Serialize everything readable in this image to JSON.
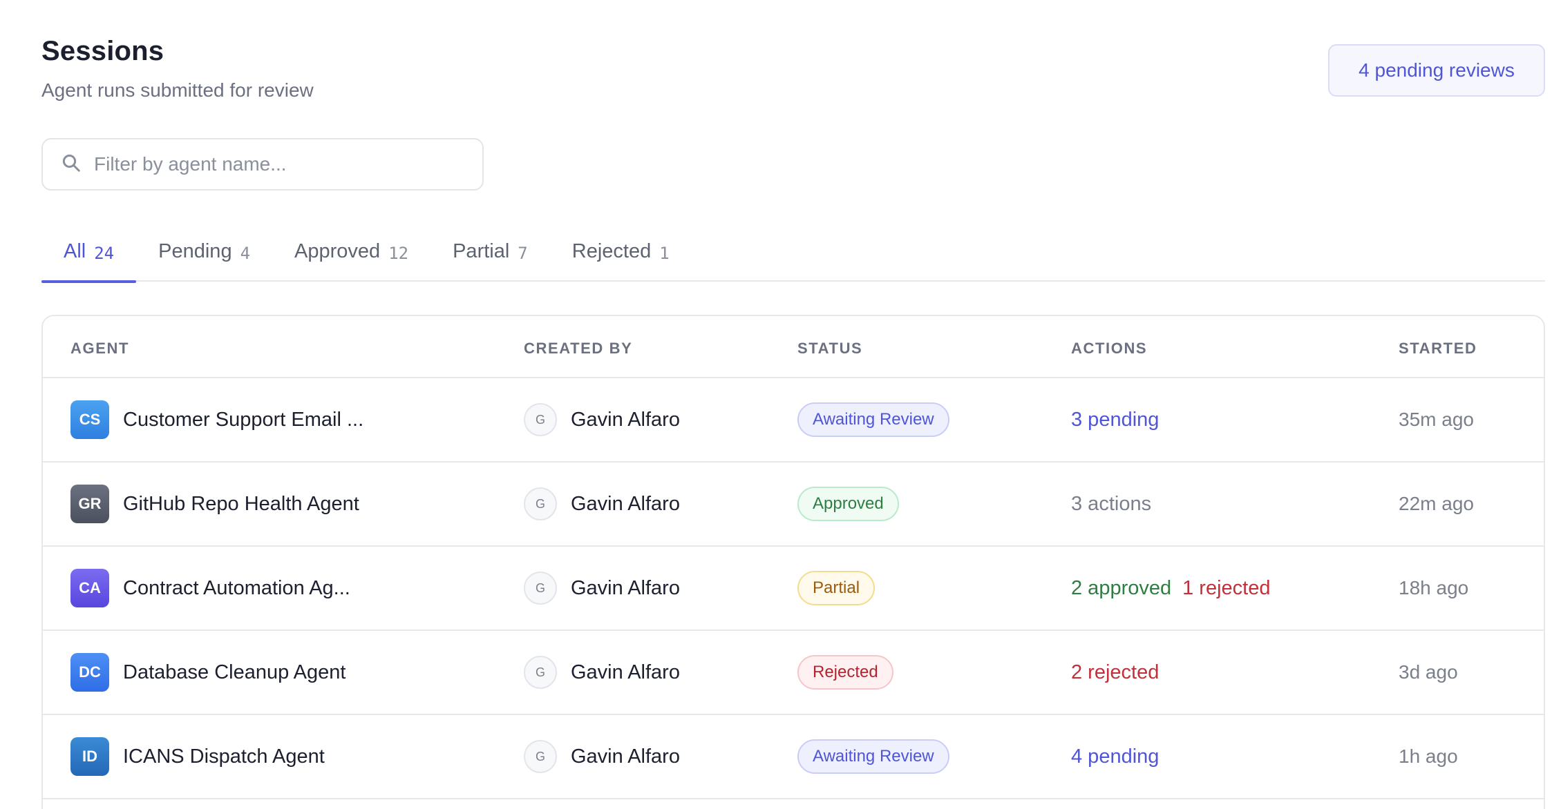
{
  "header": {
    "title": "Sessions",
    "subtitle": "Agent runs submitted for review",
    "pending_label": "4 pending reviews"
  },
  "search": {
    "placeholder": "Filter by agent name...",
    "value": ""
  },
  "tabs": [
    {
      "label": "All",
      "count": "24",
      "active": true
    },
    {
      "label": "Pending",
      "count": "4"
    },
    {
      "label": "Approved",
      "count": "12"
    },
    {
      "label": "Partial",
      "count": "7"
    },
    {
      "label": "Rejected",
      "count": "1"
    }
  ],
  "table": {
    "columns": [
      "AGENT",
      "CREATED BY",
      "STATUS",
      "ACTIONS",
      "STARTED"
    ],
    "rows": [
      {
        "initials": "CS",
        "avatar_color": "#3d8fe8",
        "agent": "Customer Support Email ...",
        "user_initial": "G",
        "created_by": "Gavin Alfaro",
        "status": "Awaiting Review",
        "status_kind": "review",
        "action_1": "3 pending",
        "action_2": "",
        "started": "35m ago"
      },
      {
        "initials": "GR",
        "avatar_color": "#5a6070",
        "agent": "GitHub Repo Health Agent",
        "user_initial": "G",
        "created_by": "Gavin Alfaro",
        "status": "Approved",
        "status_kind": "approved",
        "action_1": "3 actions",
        "action_2": "",
        "started": "22m ago"
      },
      {
        "initials": "CA",
        "avatar_color": "#6a5be6",
        "agent": "Contract Automation Ag...",
        "user_initial": "G",
        "created_by": "Gavin Alfaro",
        "status": "Partial",
        "status_kind": "partial",
        "action_1": "2 approved",
        "action_2": "1 rejected",
        "started": "18h ago"
      },
      {
        "initials": "DC",
        "avatar_color": "#3d7ff0",
        "agent": "Database Cleanup Agent",
        "user_initial": "G",
        "created_by": "Gavin Alfaro",
        "status": "Rejected",
        "status_kind": "rejected",
        "action_1": "2 rejected",
        "action_2": "",
        "started": "3d ago"
      },
      {
        "initials": "ID",
        "avatar_color": "#2b7ac9",
        "agent": "ICANS Dispatch Agent",
        "user_initial": "G",
        "created_by": "Gavin Alfaro",
        "status": "Awaiting Review",
        "status_kind": "review",
        "action_1": "4 pending",
        "action_2": "",
        "started": "1h ago"
      }
    ]
  }
}
